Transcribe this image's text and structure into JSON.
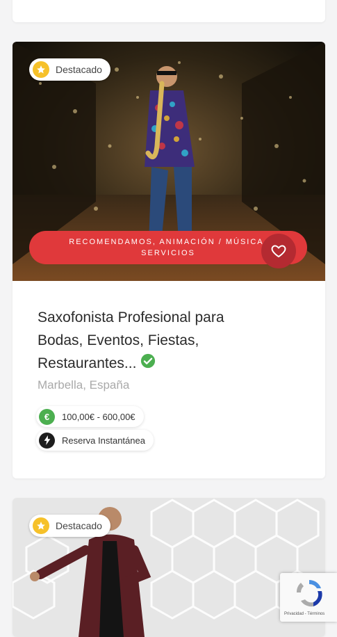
{
  "listing": {
    "featured_label": "Destacado",
    "categories_line1": "RECOMENDAMOS, ANIMACIÓN / MÚSICA,",
    "categories_line2": "SERVICIOS",
    "title_line1": "Saxofonista Profesional para",
    "title_line2": "Bodas, Eventos, Fiestas,",
    "title_line3": "Restaurantes...",
    "location": "Marbella, España",
    "price": "100,00€ - 600,00€",
    "booking": "Reserva Instantánea"
  },
  "next_listing": {
    "featured_label": "Destacado"
  },
  "recaptcha": {
    "footer": "Privacidad - Términos"
  },
  "icons": {
    "featured": "star-icon",
    "favorite": "heart-icon",
    "verified": "check-circle-icon",
    "price": "euro-icon",
    "booking": "lightning-icon"
  },
  "colors": {
    "accent_red": "#e0393b",
    "star_yellow": "#f6c12a",
    "verified_green": "#4caf50"
  }
}
